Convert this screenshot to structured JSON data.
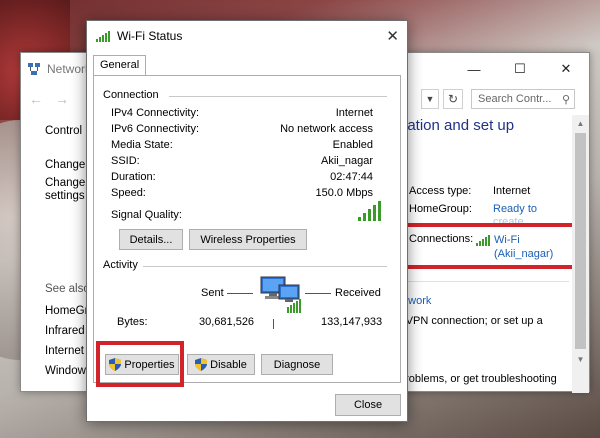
{
  "network_window": {
    "title": "Network",
    "search_placeholder": "Search Contr...",
    "left_pane": {
      "control_panel_home": "Control P",
      "change_1": "Change a",
      "change_2": "Change a",
      "change_2b": "settings",
      "see_also": "See also",
      "links": [
        "HomeGr",
        "Infrared",
        "Internet",
        "Window"
      ]
    },
    "heading": "nation and set up",
    "access_type_label": "Access type:",
    "access_type_value": "Internet",
    "homegroup_label": "HomeGroup:",
    "homegroup_value": "Ready to",
    "homegroup_value2": "create",
    "connections_label": "Connections:",
    "connections_value": "Wi-Fi",
    "connections_value2": "(Akii_nagar)",
    "bottom_link": "etwork",
    "bottom_text1": "r VPN connection; or set up a",
    "bottom_text2": "problems, or get troubleshooting"
  },
  "wifi_dialog": {
    "title": "Wi-Fi Status",
    "tab_general": "General",
    "connection_group": "Connection",
    "rows": [
      {
        "label": "IPv4 Connectivity:",
        "value": "Internet"
      },
      {
        "label": "IPv6 Connectivity:",
        "value": "No network access"
      },
      {
        "label": "Media State:",
        "value": "Enabled"
      },
      {
        "label": "SSID:",
        "value": "Akii_nagar"
      },
      {
        "label": "Duration:",
        "value": "02:47:44"
      },
      {
        "label": "Speed:",
        "value": "150.0 Mbps"
      }
    ],
    "signal_quality_label": "Signal Quality:",
    "details_button": "Details...",
    "wireless_properties_button": "Wireless Properties",
    "activity_group": "Activity",
    "sent_label": "Sent",
    "received_label": "Received",
    "bytes_label": "Bytes:",
    "bytes_sent": "30,681,526",
    "bytes_received": "133,147,933",
    "properties_button": "Properties",
    "disable_button": "Disable",
    "diagnose_button": "Diagnose",
    "close_button": "Close"
  },
  "colors": {
    "highlight_red": "#d2232a",
    "link_blue": "#1a5fb4",
    "heading_blue": "#1e3287",
    "signal_green": "#3a9a2a"
  }
}
